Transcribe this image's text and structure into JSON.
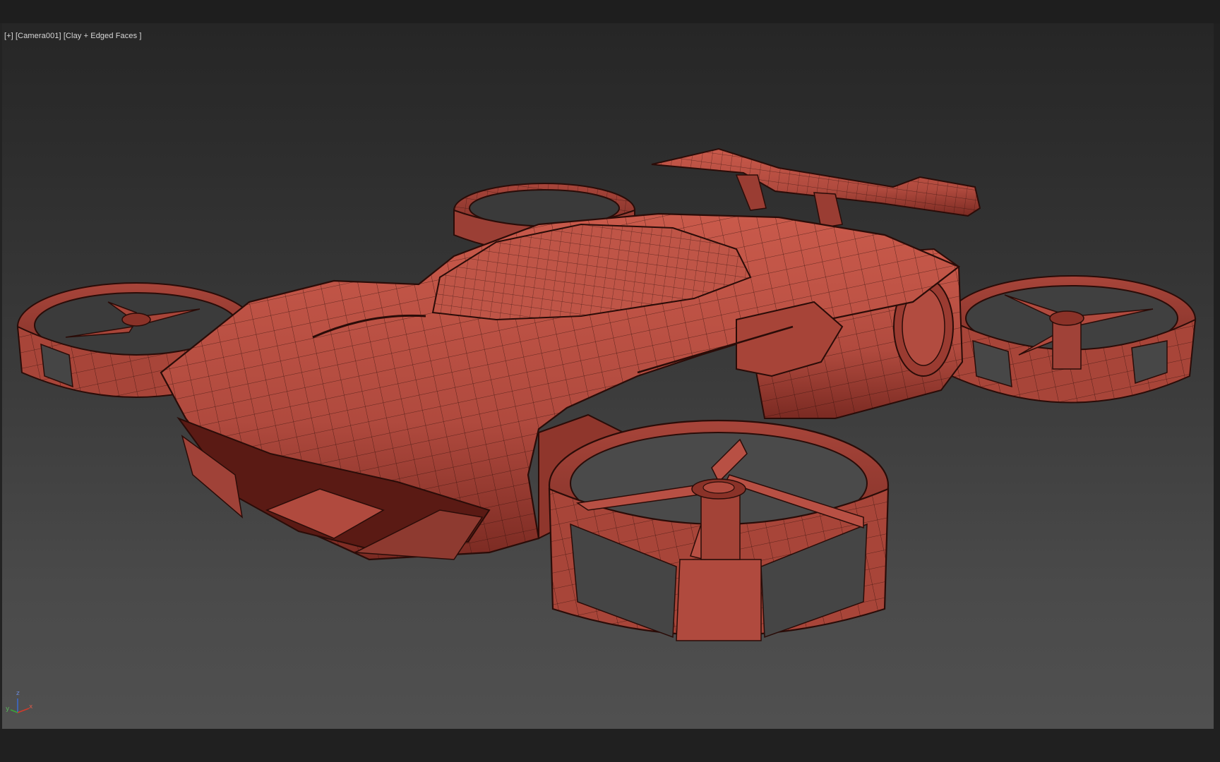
{
  "viewport": {
    "labels": {
      "plus": "[+]",
      "camera": "[Camera001]",
      "shading": "[Clay + Edged Faces ]"
    },
    "model_icon": "flying-car-drone-wireframe",
    "colors": {
      "clay": "#b04a3e",
      "clay_light": "#c95a4b",
      "clay_dark": "#7a2a22",
      "edges": "#2a0c08",
      "background_top": "#262626",
      "background_bottom": "#505050"
    }
  },
  "axis_gizmo": {
    "x_label": "x",
    "y_label": "y",
    "z_label": "z",
    "x_color": "#d23a2a",
    "y_color": "#3aa63a",
    "z_color": "#3a6ad2"
  }
}
